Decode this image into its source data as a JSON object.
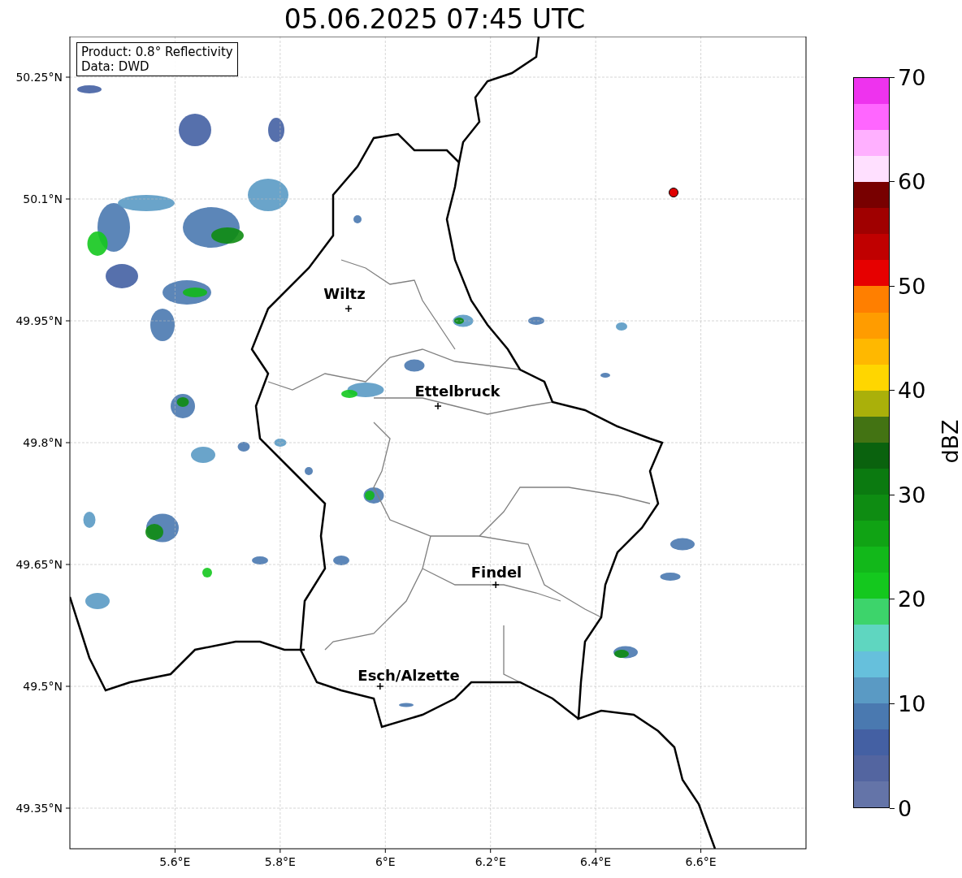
{
  "title": "05.06.2025 07:45 UTC",
  "info_box": [
    "Product: 0.8° Reflectivity",
    "Data: DWD"
  ],
  "map": {
    "x_ticks": [
      "5.6°E",
      "5.8°E",
      "6°E",
      "6.2°E",
      "6.4°E",
      "6.6°E"
    ],
    "y_ticks": [
      "50.25°N",
      "50.1°N",
      "49.95°N",
      "49.8°N",
      "49.65°N",
      "49.5°N",
      "49.35°N"
    ],
    "cities": [
      {
        "name": "Wiltz"
      },
      {
        "name": "Ettelbruck"
      },
      {
        "name": "Findel"
      },
      {
        "name": "Esch/Alzette"
      }
    ]
  },
  "colorbar": {
    "label": "dBZ",
    "ticks": [
      "70",
      "60",
      "50",
      "40",
      "30",
      "20",
      "10",
      "0"
    ],
    "bands": [
      {
        "color": "#6474a8"
      },
      {
        "color": "#5365a0"
      },
      {
        "color": "#4460a3"
      },
      {
        "color": "#4a79b0"
      },
      {
        "color": "#5a9ac4"
      },
      {
        "color": "#66c0dc"
      },
      {
        "color": "#5fd6c0"
      },
      {
        "color": "#3dd46b"
      },
      {
        "color": "#14c81e"
      },
      {
        "color": "#12b81a"
      },
      {
        "color": "#10a314"
      },
      {
        "color": "#0e8c12"
      },
      {
        "color": "#0b7a10"
      },
      {
        "color": "#0a620e"
      },
      {
        "color": "#437313"
      },
      {
        "color": "#aab00a"
      },
      {
        "color": "#ffd600"
      },
      {
        "color": "#ffb800"
      },
      {
        "color": "#ff9c00"
      },
      {
        "color": "#ff7f00"
      },
      {
        "color": "#e60000"
      },
      {
        "color": "#c00000"
      },
      {
        "color": "#a00000"
      },
      {
        "color": "#780000"
      },
      {
        "color": "#ffe0ff"
      },
      {
        "color": "#ffb0ff"
      },
      {
        "color": "#ff66ff"
      },
      {
        "color": "#ee33ee"
      }
    ]
  }
}
